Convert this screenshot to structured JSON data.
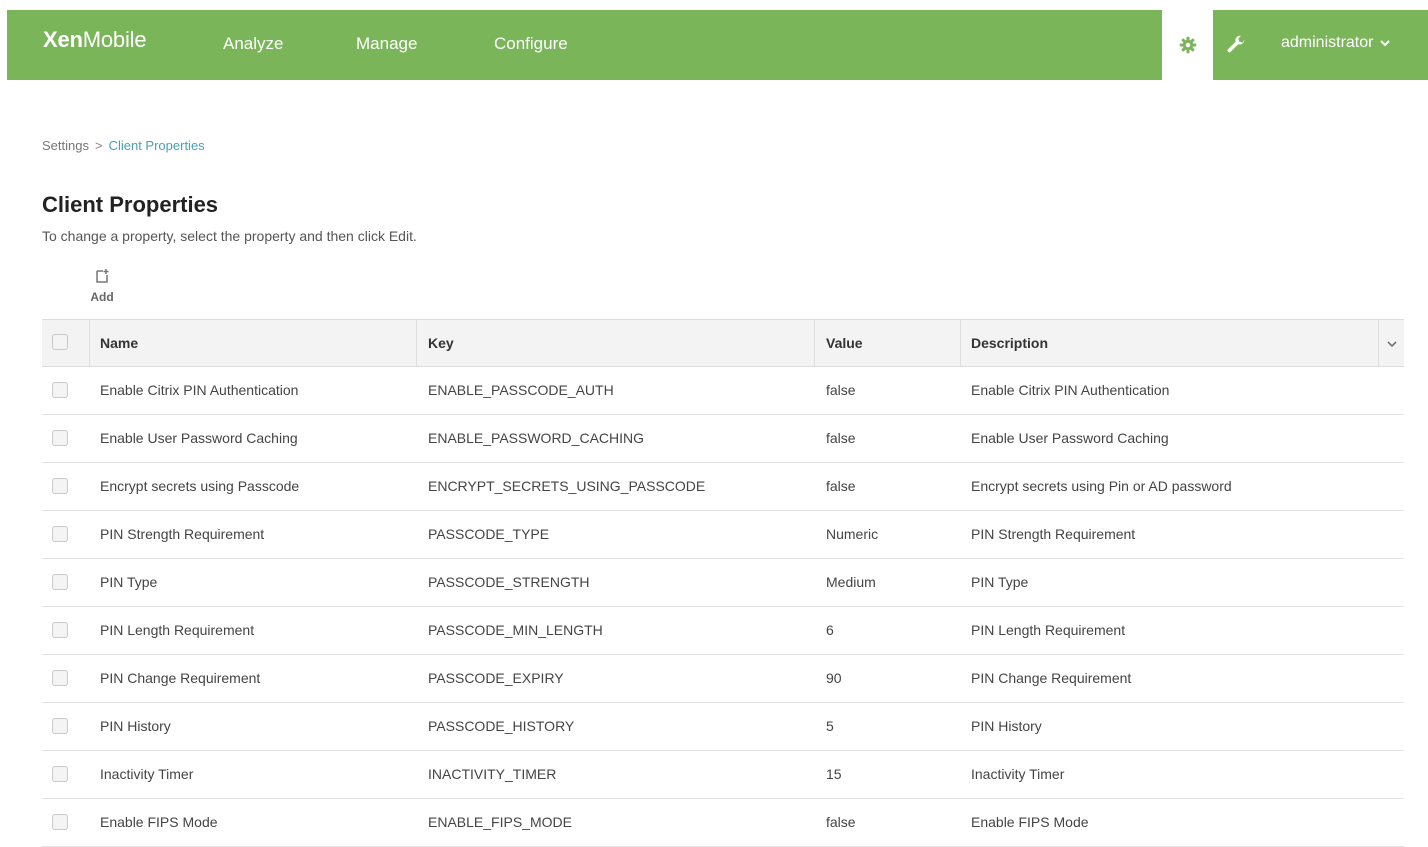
{
  "header": {
    "brand_bold": "Xen",
    "brand_light": "Mobile",
    "nav": [
      "Analyze",
      "Manage",
      "Configure"
    ],
    "user": "administrator",
    "colors": {
      "bar": "#7ab659",
      "accent": "#4aa1b6"
    },
    "icons": [
      "gear-icon",
      "wrench-icon",
      "chevron-down-icon"
    ]
  },
  "breadcrumb": {
    "root": "Settings",
    "separator": ">",
    "current": "Client Properties"
  },
  "page": {
    "title": "Client Properties",
    "subtitle": "To change a property, select the property and then click Edit.",
    "add_label": "Add"
  },
  "table": {
    "columns": [
      "Name",
      "Key",
      "Value",
      "Description"
    ],
    "rows": [
      [
        "Enable Citrix PIN Authentication",
        "ENABLE_PASSCODE_AUTH",
        "false",
        "Enable Citrix PIN Authentication"
      ],
      [
        "Enable User Password Caching",
        "ENABLE_PASSWORD_CACHING",
        "false",
        "Enable User Password Caching"
      ],
      [
        "Encrypt secrets using Passcode",
        "ENCRYPT_SECRETS_USING_PASSCODE",
        "false",
        "Encrypt secrets using Pin or AD password"
      ],
      [
        "PIN Strength Requirement",
        "PASSCODE_TYPE",
        "Numeric",
        "PIN Strength Requirement"
      ],
      [
        "PIN Type",
        "PASSCODE_STRENGTH",
        "Medium",
        "PIN Type"
      ],
      [
        "PIN Length Requirement",
        "PASSCODE_MIN_LENGTH",
        "6",
        "PIN Length Requirement"
      ],
      [
        "PIN Change Requirement",
        "PASSCODE_EXPIRY",
        "90",
        "PIN Change Requirement"
      ],
      [
        "PIN History",
        "PASSCODE_HISTORY",
        "5",
        "PIN History"
      ],
      [
        "Inactivity Timer",
        "INACTIVITY_TIMER",
        "15",
        "Inactivity Timer"
      ],
      [
        "Enable FIPS Mode",
        "ENABLE_FIPS_MODE",
        "false",
        "Enable FIPS Mode"
      ]
    ]
  }
}
